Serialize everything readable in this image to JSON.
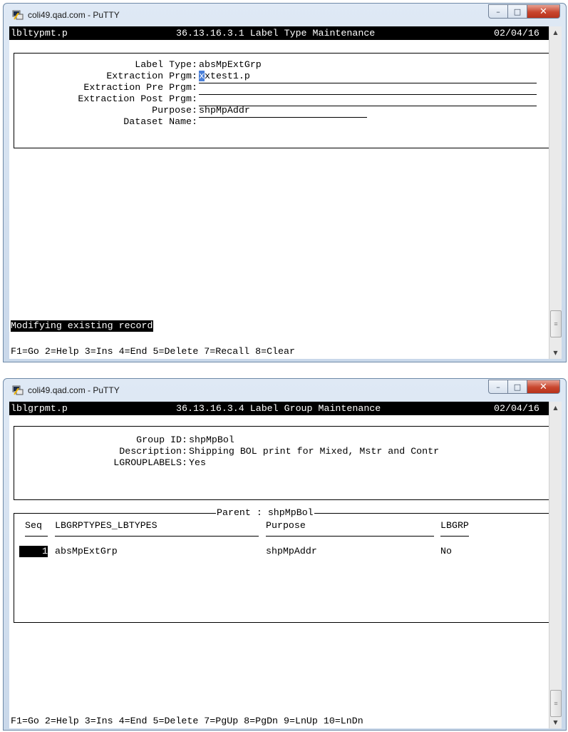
{
  "window1": {
    "title": "coli49.qad.com - PuTTY",
    "header": {
      "program": "lbltypmt.p",
      "menu": "36.13.16.3.1 Label Type Maintenance",
      "date": "02/04/16"
    },
    "fields": [
      {
        "label": "Label Type:",
        "value": "absMpExtGrp"
      },
      {
        "label": "Extraction Prgm:",
        "cursor_char": "x",
        "value_rest": "xtest1.p"
      },
      {
        "label": "Extraction Pre Prgm:",
        "value": ""
      },
      {
        "label": "Extraction Post Prgm:",
        "value": ""
      },
      {
        "label": "Purpose:",
        "value": "shpMpAddr"
      },
      {
        "label": "Dataset Name:",
        "value": ""
      }
    ],
    "status": "Modifying existing record",
    "function_keys": "F1=Go 2=Help 3=Ins 4=End 5=Delete 7=Recall 8=Clear"
  },
  "window2": {
    "title": "coli49.qad.com - PuTTY",
    "header": {
      "program": "lblgrpmt.p",
      "menu": "36.13.16.3.4 Label Group Maintenance",
      "date": "02/04/16"
    },
    "fields": [
      {
        "label": "Group ID:",
        "value": "shpMpBol"
      },
      {
        "label": "Description:",
        "value": "Shipping BOL print for Mixed, Mstr and Contr"
      },
      {
        "label": "LGROUPLABELS:",
        "value": "Yes"
      }
    ],
    "frame_title": "Parent : shpMpBol",
    "columns": {
      "seq": "Seq",
      "types": "LBGRPTYPES_LBTYPES",
      "purpose": "Purpose",
      "lbgrp": "LBGRP"
    },
    "rows": [
      {
        "seq": "1",
        "types": "absMpExtGrp",
        "purpose": "shpMpAddr",
        "lbgrp": "No"
      }
    ],
    "function_keys": "F1=Go 2=Help 3=Ins 4=End 5=Delete 7=PgUp 8=PgDn 9=LnUp 10=LnDn"
  },
  "icons": {
    "app": "putty-icon",
    "minimize": "minimize-icon",
    "maximize": "maximize-icon",
    "close": "close-icon"
  },
  "colors": {
    "terminal_bg": "#ffffff",
    "header_bg": "#000000",
    "cursor": "#4a7fd8",
    "close_button": "#c8462e"
  }
}
